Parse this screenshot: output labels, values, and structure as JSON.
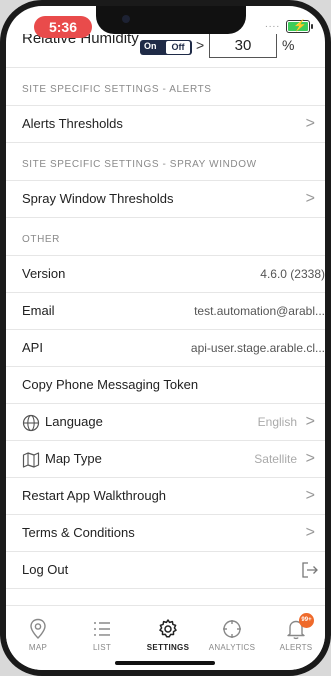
{
  "status_bar": {
    "time": "5:36",
    "signal": "....",
    "battery_level": 1.0
  },
  "partial_row": {
    "label": "Relative Humidity",
    "toggle_on": "On",
    "toggle_off": "Off",
    "operator": ">",
    "value": "30",
    "unit": "%"
  },
  "sections": {
    "alerts": {
      "header": "SITE SPECIFIC SETTINGS - ALERTS",
      "item": "Alerts Thresholds"
    },
    "spray": {
      "header": "SITE SPECIFIC SETTINGS - SPRAY WINDOW",
      "item": "Spray Window Thresholds"
    },
    "other": {
      "header": "OTHER",
      "version_label": "Version",
      "version_value": "4.6.0 (2338)",
      "email_label": "Email",
      "email_value": "test.automation@arabl...",
      "api_label": "API",
      "api_value": "api-user.stage.arable.cl...",
      "copy_token": "Copy Phone Messaging Token",
      "language_label": "Language",
      "language_value": "English",
      "map_type_label": "Map Type",
      "map_type_value": "Satellite",
      "walkthrough": "Restart App Walkthrough",
      "terms": "Terms & Conditions",
      "logout": "Log Out"
    }
  },
  "chevron": ">",
  "tabs": {
    "map": "MAP",
    "list": "LIST",
    "settings": "SETTINGS",
    "analytics": "ANALYTICS",
    "alerts": "ALERTS",
    "alerts_badge": "99+",
    "active": "settings"
  },
  "colors": {
    "time_pill": "#e94b4b",
    "battery": "#3dcc5a",
    "badge": "#ef6a2b",
    "toggle": "#1f2b47"
  },
  "icons": {
    "language": "globe-icon",
    "map_type": "map-icon",
    "logout": "logout-icon",
    "chevron": "chevron-right-icon"
  }
}
